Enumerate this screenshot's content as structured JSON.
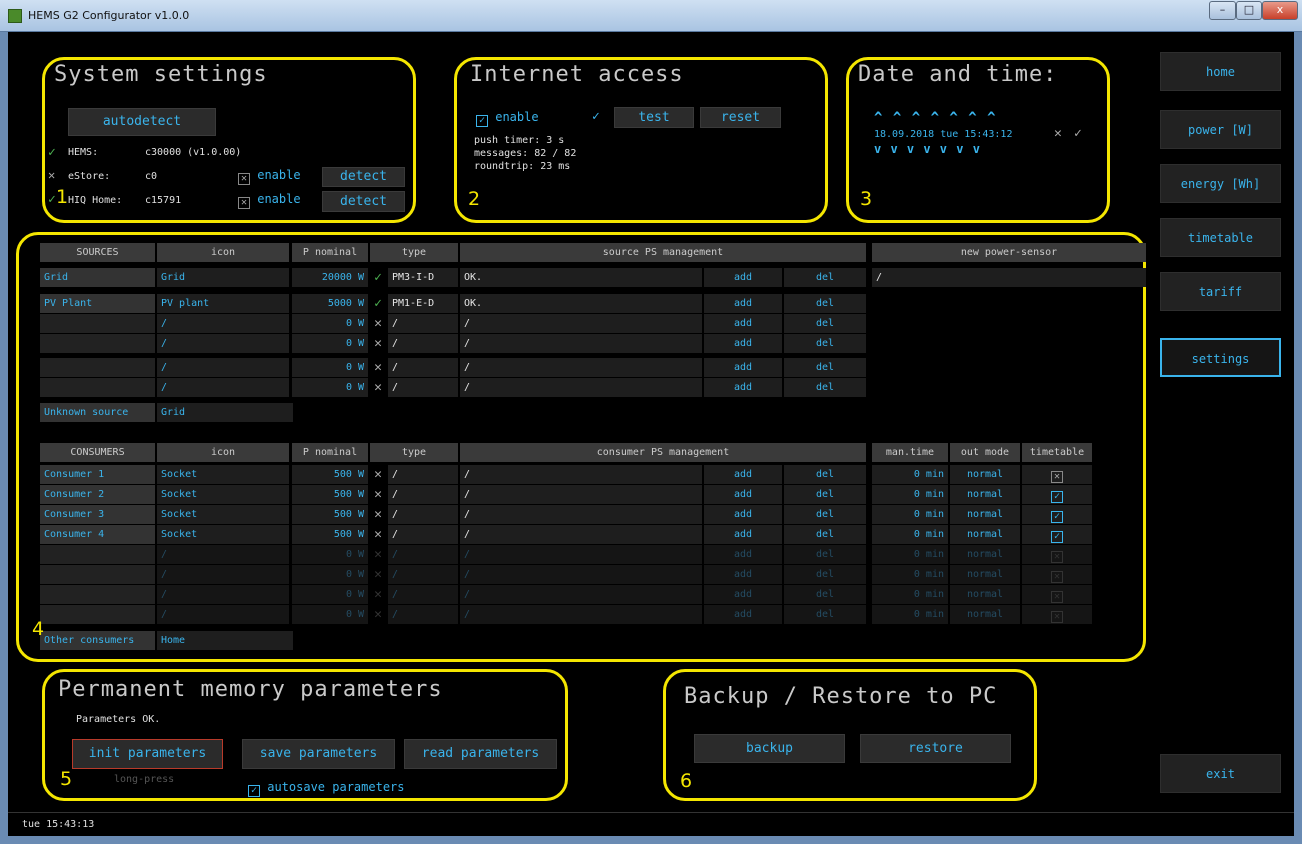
{
  "window": {
    "title": "HEMS G2 Configurator v1.0.0",
    "min": "–",
    "max": "□",
    "close": "x"
  },
  "system": {
    "title": "System settings",
    "autodetect": "autodetect",
    "hems_label": "HEMS:",
    "hems_value": "c30000 (v1.0.00)",
    "estore_label": "eStore:",
    "estore_value": "c0",
    "hiq_label": "HIQ Home:",
    "hiq_value": "c15791",
    "enable": "enable",
    "detect": "detect",
    "num": "1"
  },
  "internet": {
    "title": "Internet access",
    "enable": "enable",
    "test": "test",
    "reset": "reset",
    "push": "push timer: 3 s",
    "messages": "messages: 82 / 82",
    "roundtrip": "roundtrip: 23 ms",
    "num": "2"
  },
  "datetime": {
    "title": "Date and time:",
    "value": "18.09.2018 tue 15:43:12",
    "up": "^ ^  ^  ^ ^ ^ ^",
    "down": "v v  v  v v v v",
    "num": "3"
  },
  "nav": {
    "home": "home",
    "power": "power [W]",
    "energy": "energy [Wh]",
    "timetable": "timetable",
    "tariff": "tariff",
    "settings": "settings",
    "exit": "exit"
  },
  "sources": {
    "headers": [
      "SOURCES",
      "icon",
      "P nominal",
      "type",
      "source PS management",
      "new power-sensor"
    ],
    "rows": [
      {
        "name": "Grid",
        "icon": "Grid",
        "p": "20000 W",
        "type": "PM3-I-D",
        "ps": "OK.",
        "add": "add",
        "del": "del"
      },
      {
        "name": "PV Plant",
        "icon": "PV plant",
        "p": "5000 W",
        "type": "PM1-E-D",
        "ps": "OK.",
        "add": "add",
        "del": "del"
      },
      {
        "name": "",
        "icon": "/",
        "p": "0 W",
        "type": "/",
        "ps": "/",
        "add": "add",
        "del": "del"
      },
      {
        "name": "",
        "icon": "/",
        "p": "0 W",
        "type": "/",
        "ps": "/",
        "add": "add",
        "del": "del"
      },
      {
        "name": "",
        "icon": "/",
        "p": "0 W",
        "type": "/",
        "ps": "/",
        "add": "add",
        "del": "del"
      },
      {
        "name": "",
        "icon": "/",
        "p": "0 W",
        "type": "/",
        "ps": "/",
        "add": "add",
        "del": "del"
      }
    ],
    "new_sensor": "/",
    "unknown_label": "Unknown source",
    "unknown_value": "Grid"
  },
  "consumers": {
    "headers": [
      "CONSUMERS",
      "icon",
      "P nominal",
      "type",
      "consumer PS management",
      "man.time",
      "out mode",
      "timetable"
    ],
    "rows": [
      {
        "name": "Consumer 1",
        "icon": "Socket",
        "p": "500 W",
        "type": "/",
        "ps": "/",
        "add": "add",
        "del": "del",
        "mt": "0 min",
        "mode": "normal",
        "tt": "x"
      },
      {
        "name": "Consumer 2",
        "icon": "Socket",
        "p": "500 W",
        "type": "/",
        "ps": "/",
        "add": "add",
        "del": "del",
        "mt": "0 min",
        "mode": "normal",
        "tt": "v"
      },
      {
        "name": "Consumer 3",
        "icon": "Socket",
        "p": "500 W",
        "type": "/",
        "ps": "/",
        "add": "add",
        "del": "del",
        "mt": "0 min",
        "mode": "normal",
        "tt": "v"
      },
      {
        "name": "Consumer 4",
        "icon": "Socket",
        "p": "500 W",
        "type": "/",
        "ps": "/",
        "add": "add",
        "del": "del",
        "mt": "0 min",
        "mode": "normal",
        "tt": "v"
      },
      {
        "name": "",
        "icon": "/",
        "p": "0 W",
        "type": "/",
        "ps": "/",
        "add": "add",
        "del": "del",
        "mt": "0 min",
        "mode": "normal",
        "tt": "x"
      },
      {
        "name": "",
        "icon": "/",
        "p": "0 W",
        "type": "/",
        "ps": "/",
        "add": "add",
        "del": "del",
        "mt": "0 min",
        "mode": "normal",
        "tt": "x"
      },
      {
        "name": "",
        "icon": "/",
        "p": "0 W",
        "type": "/",
        "ps": "/",
        "add": "add",
        "del": "del",
        "mt": "0 min",
        "mode": "normal",
        "tt": "x"
      },
      {
        "name": "",
        "icon": "/",
        "p": "0 W",
        "type": "/",
        "ps": "/",
        "add": "add",
        "del": "del",
        "mt": "0 min",
        "mode": "normal",
        "tt": "x"
      }
    ],
    "other_label": "Other consumers",
    "other_value": "Home",
    "num": "4"
  },
  "memory": {
    "title": "Permanent memory parameters",
    "status": "Parameters OK.",
    "init": "init parameters",
    "longpress": "long-press",
    "save": "save parameters",
    "read": "read parameters",
    "autosave": "autosave parameters",
    "num": "5"
  },
  "backup": {
    "title": "Backup / Restore to PC",
    "backup": "backup",
    "restore": "restore",
    "num": "6"
  },
  "status": {
    "time": "tue 15:43:13"
  }
}
